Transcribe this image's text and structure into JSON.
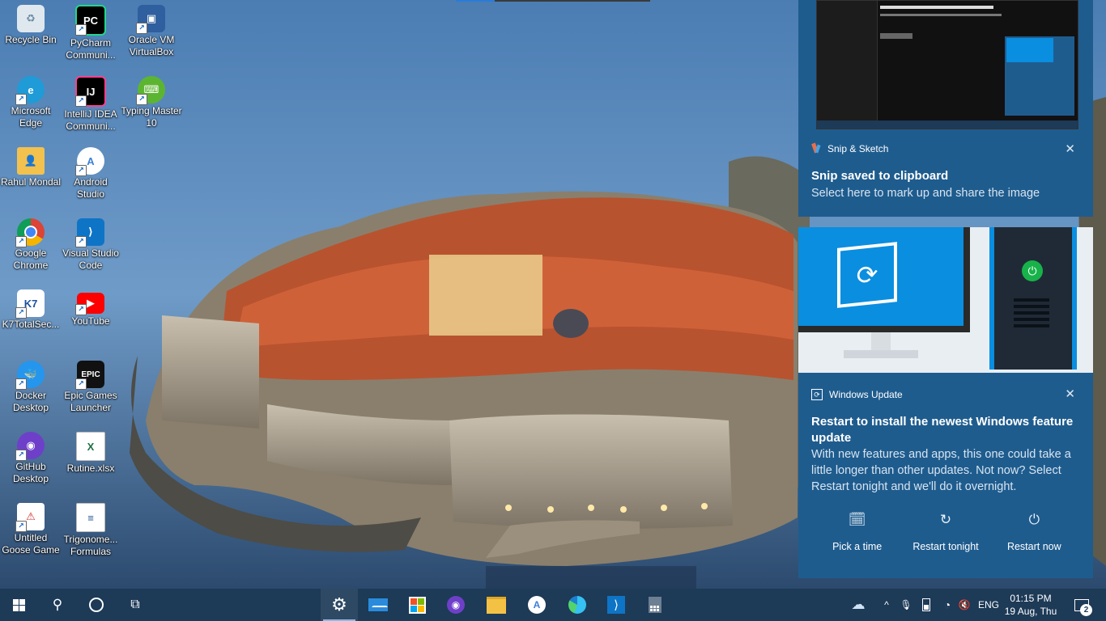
{
  "desktop_icons": [
    {
      "label": "Recycle Bin",
      "icon": "recycle-bin-icon"
    },
    {
      "label": "PyCharm Communi...",
      "icon": "pycharm-icon"
    },
    {
      "label": "Oracle VM VirtualBox",
      "icon": "virtualbox-icon"
    },
    {
      "label": "Microsoft Edge",
      "icon": "edge-icon"
    },
    {
      "label": "IntelliJ IDEA Communi...",
      "icon": "intellij-icon"
    },
    {
      "label": "Typing Master 10",
      "icon": "typing-master-icon"
    },
    {
      "label": "Rahul Mondal",
      "icon": "user-folder-icon"
    },
    {
      "label": "Android Studio",
      "icon": "android-studio-icon"
    },
    {
      "label": "Google Chrome",
      "icon": "chrome-icon"
    },
    {
      "label": "Visual Studio Code",
      "icon": "vscode-icon"
    },
    {
      "label": "K7TotalSec...",
      "icon": "k7-security-icon"
    },
    {
      "label": "YouTube",
      "icon": "youtube-icon"
    },
    {
      "label": "Docker Desktop",
      "icon": "docker-icon"
    },
    {
      "label": "Epic Games Launcher",
      "icon": "epic-games-icon"
    },
    {
      "label": "GitHub Desktop",
      "icon": "github-desktop-icon"
    },
    {
      "label": "Rutine.xlsx",
      "icon": "excel-file-icon"
    },
    {
      "label": "Untitled Goose Game",
      "icon": "goose-game-icon"
    },
    {
      "label": "Trigonome... Formulas",
      "icon": "document-file-icon"
    }
  ],
  "notifications": {
    "snip": {
      "app": "Snip & Sketch",
      "title": "Snip saved to clipboard",
      "body": "Select here to mark up and share the image"
    },
    "update": {
      "app": "Windows Update",
      "title": "Restart to install the newest Windows feature update",
      "body": "With new features and apps, this one could take a little longer than other updates. Not now? Select Restart tonight and we'll do it overnight.",
      "actions": [
        {
          "label": "Pick a time",
          "icon": "calendar-clock-icon"
        },
        {
          "label": "Restart tonight",
          "icon": "restart-icon"
        },
        {
          "label": "Restart now",
          "icon": "power-icon"
        }
      ]
    }
  },
  "taskbar": {
    "apps": [
      "start",
      "search",
      "cortana",
      "task-view",
      "settings",
      "mail",
      "store",
      "github-desktop",
      "file-explorer",
      "android-studio",
      "edge",
      "vscode",
      "calculator"
    ],
    "tray": {
      "language": "ENG",
      "time": "01:15 PM",
      "date": "19 Aug, Thu",
      "notification_count": "2"
    }
  },
  "colors": {
    "toast_bg": "#1f5c8e",
    "taskbar_bg": "#1d3a57"
  }
}
